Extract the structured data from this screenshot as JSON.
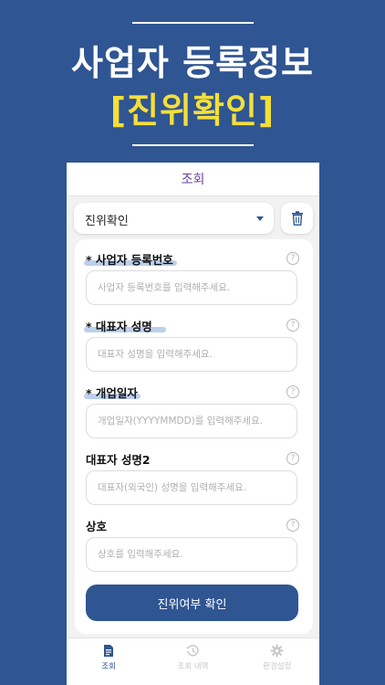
{
  "promo": {
    "headline1": "사업자 등록정보",
    "headline2": "[진위확인]",
    "accent_color": "#f4df3a"
  },
  "app": {
    "top_title": "조회",
    "select": {
      "value": "진위확인",
      "icon": "chevron-down-icon"
    },
    "delete_icon": "trash-icon",
    "fields": [
      {
        "label": "* 사업자 등록번호",
        "placeholder": "사업자 등록번호를 입력해주세요.",
        "required": true
      },
      {
        "label": "* 대표자 성명",
        "placeholder": "대표자 성명을 입력해주세요.",
        "required": true
      },
      {
        "label": "* 개업일자",
        "placeholder": "개업일자(YYYYMMDD)를 입력해주세요.",
        "required": true
      },
      {
        "label": "대표자 성명2",
        "placeholder": "대표자(외국인) 성명을 입력해주세요.",
        "required": false
      },
      {
        "label": "상호",
        "placeholder": "상호를 입력해주세요.",
        "required": false
      }
    ],
    "help_glyph": "?",
    "submit_label": "진위여부 확인",
    "nav": [
      {
        "label": "조회",
        "icon": "document-icon",
        "active": true
      },
      {
        "label": "조회 내역",
        "icon": "history-icon",
        "active": false
      },
      {
        "label": "환경설정",
        "icon": "gear-icon",
        "active": false
      }
    ],
    "brand_color": "#2f5592"
  }
}
